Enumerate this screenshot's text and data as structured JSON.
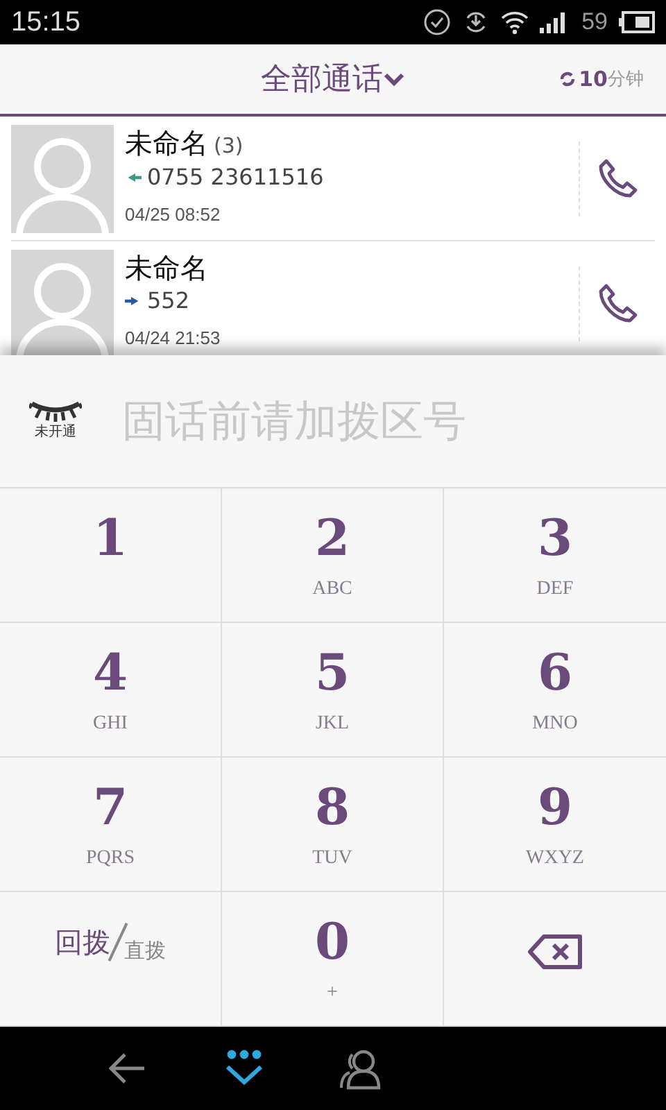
{
  "status_bar": {
    "time": "15:15",
    "battery": "59"
  },
  "header": {
    "title": "全部通话",
    "timer_value": "10",
    "timer_unit": "分钟"
  },
  "calls": [
    {
      "name": "未命名",
      "count": "(3)",
      "outgoing": false,
      "number": "0755 23611516",
      "time": "04/25  08:52"
    },
    {
      "name": "未命名",
      "outgoing": true,
      "number": "552",
      "time": "04/24  21:53"
    }
  ],
  "dial_field": {
    "status_label": "未开通",
    "placeholder": "固话前请加拨区号"
  },
  "keys": [
    {
      "kind": "digit",
      "digit": "1"
    },
    {
      "kind": "digit",
      "digit": "2",
      "letters": "ABC"
    },
    {
      "kind": "digit",
      "digit": "3",
      "letters": "DEF"
    },
    {
      "kind": "digit",
      "digit": "4",
      "letters": "GHI"
    },
    {
      "kind": "digit",
      "digit": "5",
      "letters": "JKL"
    },
    {
      "kind": "digit",
      "digit": "6",
      "letters": "MNO"
    },
    {
      "kind": "digit",
      "digit": "7",
      "letters": "PQRS"
    },
    {
      "kind": "digit",
      "digit": "8",
      "letters": "TUV"
    },
    {
      "kind": "digit",
      "digit": "9",
      "letters": "WXYZ"
    },
    {
      "kind": "mode",
      "primary": "回拨",
      "secondary": "直拨"
    },
    {
      "kind": "digit",
      "digit": "0",
      "letters": "+"
    },
    {
      "kind": "delete"
    }
  ],
  "nav": [
    {
      "kind": "back",
      "selected": false
    },
    {
      "kind": "dialpad",
      "selected": true
    },
    {
      "kind": "contacts",
      "selected": false
    }
  ]
}
